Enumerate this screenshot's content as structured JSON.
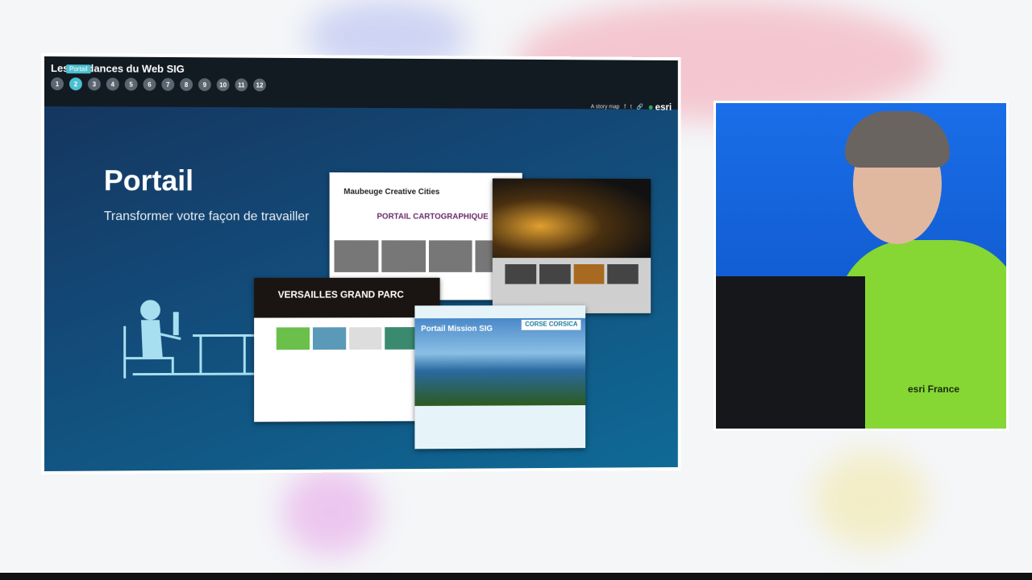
{
  "story_map": {
    "title": "Les tendances du Web SIG",
    "tooltip": "Portail",
    "sections": [
      "1",
      "2",
      "3",
      "4",
      "5",
      "6",
      "7",
      "8",
      "9",
      "10",
      "11",
      "12"
    ],
    "active_section": 2,
    "story_label": "A story map",
    "brand": "esri"
  },
  "slide": {
    "heading": "Portail",
    "subtitle": "Transformer votre façon de travailler"
  },
  "screenshots": {
    "maubeuge_logo": "Maubeuge Creative Cities",
    "maubeuge_title": "PORTAIL CARTOGRAPHIQUE",
    "versailles": "VERSAILLES GRAND PARC",
    "corse_title": "Portail Mission SIG",
    "corse_logo": "CORSE CORSICA"
  },
  "speaker": {
    "shirt_logo": "esri France"
  }
}
